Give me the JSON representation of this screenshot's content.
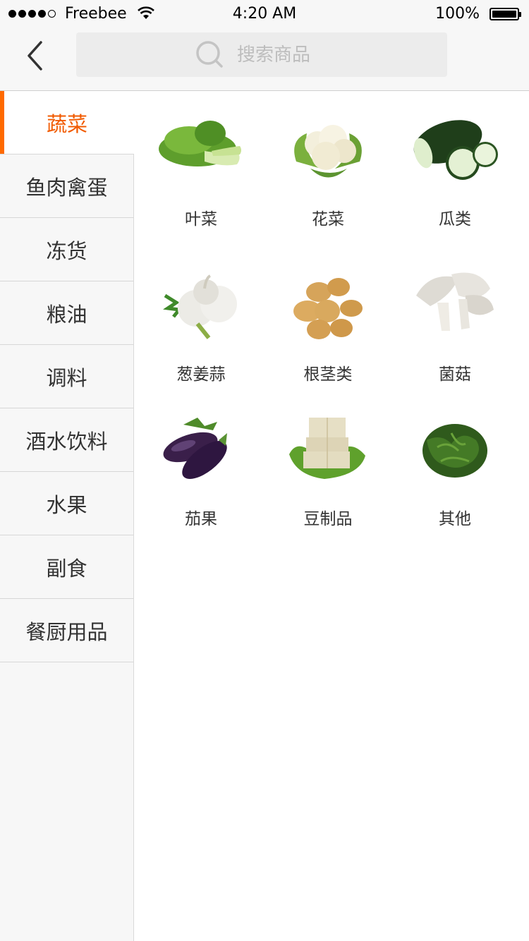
{
  "status_bar": {
    "carrier": "Freebee",
    "time": "4:20 AM",
    "battery": "100%"
  },
  "nav": {
    "back_icon": "chevron-left-icon",
    "search_icon": "search-icon",
    "search_placeholder": "搜索商品"
  },
  "sidebar": {
    "items": [
      {
        "label": "蔬菜",
        "active": true
      },
      {
        "label": "鱼肉禽蛋",
        "active": false
      },
      {
        "label": "冻货",
        "active": false
      },
      {
        "label": "粮油",
        "active": false
      },
      {
        "label": "调料",
        "active": false
      },
      {
        "label": "酒水饮料",
        "active": false
      },
      {
        "label": "水果",
        "active": false
      },
      {
        "label": "副食",
        "active": false
      },
      {
        "label": "餐厨用品",
        "active": false
      }
    ]
  },
  "subcategories": [
    {
      "label": "叶菜",
      "icon": "bok-choy-image"
    },
    {
      "label": "花菜",
      "icon": "cauliflower-image"
    },
    {
      "label": "瓜类",
      "icon": "winter-melon-image"
    },
    {
      "label": "葱姜蒜",
      "icon": "garlic-image"
    },
    {
      "label": "根茎类",
      "icon": "potato-image"
    },
    {
      "label": "菌菇",
      "icon": "mushroom-image"
    },
    {
      "label": "茄果",
      "icon": "eggplant-image"
    },
    {
      "label": "豆制品",
      "icon": "tofu-image"
    },
    {
      "label": "其他",
      "icon": "seaweed-image"
    }
  ],
  "colors": {
    "accent": "#ff6a00",
    "active_text": "#f15a00",
    "sidebar_bg": "#f7f7f7"
  }
}
